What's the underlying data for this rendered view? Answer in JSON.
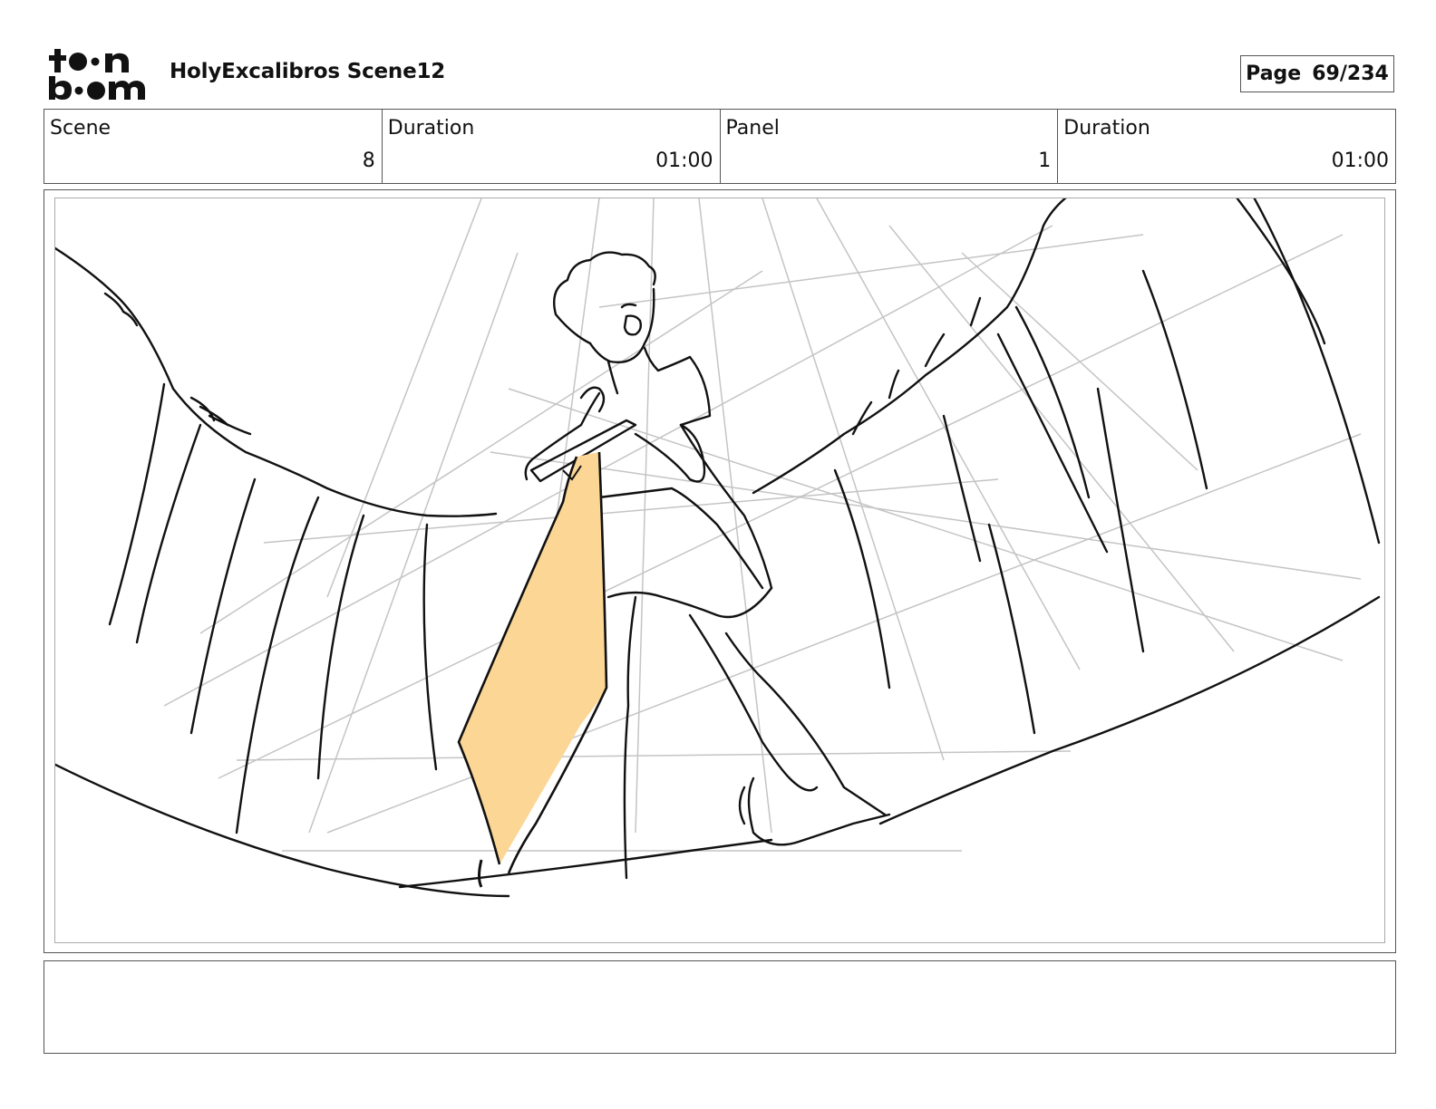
{
  "header": {
    "logo_text": "toonboom",
    "title": "HolyExcalibros Scene12",
    "page_label": "Page",
    "page_value": "69/234"
  },
  "info": {
    "scene_label": "Scene",
    "scene_value": "8",
    "scene_duration_label": "Duration",
    "scene_duration_value": "01:00",
    "panel_label": "Panel",
    "panel_value": "1",
    "panel_duration_label": "Duration",
    "panel_duration_value": "01:00"
  },
  "panel": {
    "sword_color": "#fcd695",
    "line_color": "#111111",
    "guide_color": "#bdbdbd"
  },
  "notes": {
    "text": ""
  }
}
